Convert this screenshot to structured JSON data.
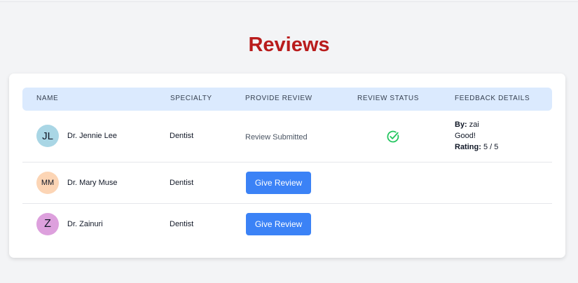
{
  "page": {
    "title": "Reviews"
  },
  "table": {
    "headers": [
      "Name",
      "Specialty",
      "Provide Review",
      "Review Status",
      "Feedback Details"
    ],
    "rows": [
      {
        "initials": "JL",
        "name": "Dr. Jennie Lee",
        "specialty": "Dentist",
        "review_text": "Review Submitted",
        "status_icon": "check-circle-icon",
        "feedback": {
          "by_label": "By:",
          "by_value": "zai",
          "comment": "Good!",
          "rating_label": "Rating:",
          "rating_value": "5 / 5"
        }
      },
      {
        "initials": "MM",
        "name": "Dr. Mary Muse",
        "specialty": "Dentist",
        "button_label": "Give Review"
      },
      {
        "initials": "Z",
        "name": "Dr. Zainuri",
        "specialty": "Dentist",
        "button_label": "Give Review"
      }
    ]
  },
  "colors": {
    "title": "#b91c1c",
    "header_bg": "#dbeafe",
    "button": "#3b82f6",
    "success": "#22c55e",
    "avatar_jl": "#a9d6e5",
    "avatar_mm": "#fcd5b5",
    "avatar_z": "#dda0dd"
  }
}
